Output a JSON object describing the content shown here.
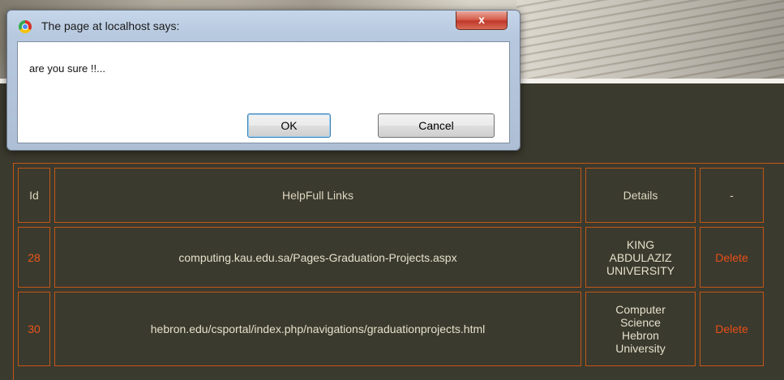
{
  "dialog": {
    "title": "The page at localhost says:",
    "close_label": "x",
    "message": "are you sure !!...",
    "ok_label": "OK",
    "cancel_label": "Cancel"
  },
  "table": {
    "headers": {
      "id": "Id",
      "links": "HelpFull Links",
      "details": "Details",
      "action": "-"
    },
    "rows": [
      {
        "id": "28",
        "link": "computing.kau.edu.sa/Pages-Graduation-Projects.aspx",
        "details": [
          "KING",
          "ABDULAZIZ",
          "UNIVERSITY"
        ],
        "action": "Delete"
      },
      {
        "id": "30",
        "link": "hebron.edu/csportal/index.php/navigations/graduationprojects.html",
        "details": [
          "Computer",
          "Science",
          "Hebron",
          "University"
        ],
        "action": "Delete"
      }
    ]
  },
  "colors": {
    "page_background": "#3b3a2e",
    "table_border": "#c25716",
    "id_and_delete": "#e8561a",
    "cell_text": "#e6e1cc"
  }
}
